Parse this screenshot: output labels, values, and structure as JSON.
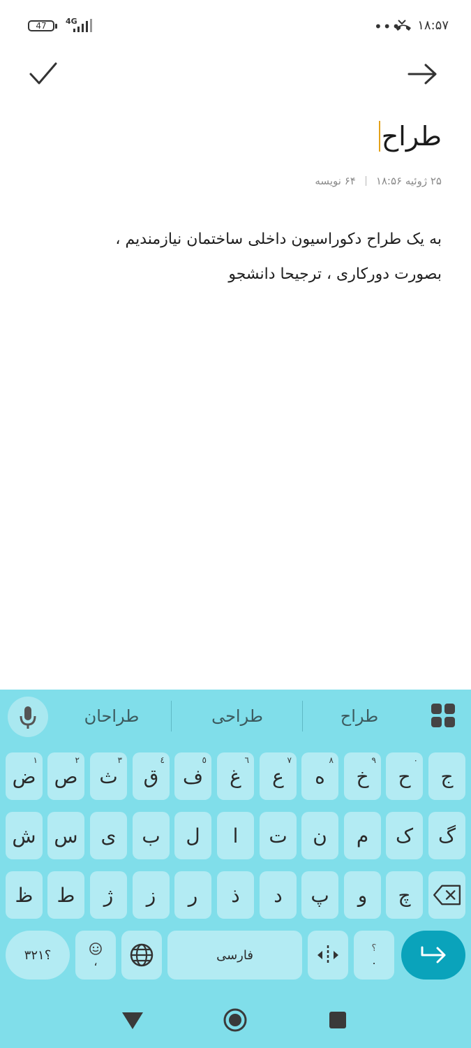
{
  "status_bar": {
    "battery": "47",
    "network": "4G",
    "time": "۱۸:۵۷",
    "more": "•••"
  },
  "note": {
    "title": "طراح",
    "date": "۲۵ ژوئیه ۱۸:۵۶",
    "char_count": "۶۴ نویسه",
    "line1": "به یک طراح دکوراسیون داخلی ساختمان نیازمندیم ،",
    "line2": "بصورت دورکاری ، ترجیحا دانشجو"
  },
  "keyboard": {
    "suggestions": [
      "طراح",
      "طراحی",
      "طراحان"
    ],
    "row1": [
      {
        "k": "ج",
        "h": ""
      },
      {
        "k": "ح",
        "h": "٠"
      },
      {
        "k": "خ",
        "h": "٩"
      },
      {
        "k": "ه",
        "h": "٨"
      },
      {
        "k": "ع",
        "h": "٧"
      },
      {
        "k": "غ",
        "h": "٦"
      },
      {
        "k": "ف",
        "h": "٥"
      },
      {
        "k": "ق",
        "h": "٤"
      },
      {
        "k": "ث",
        "h": "٣"
      },
      {
        "k": "ص",
        "h": "٢"
      },
      {
        "k": "ض",
        "h": "١"
      }
    ],
    "row2": [
      "گ",
      "ک",
      "م",
      "ن",
      "ت",
      "ا",
      "ل",
      "ب",
      "ی",
      "س",
      "ش"
    ],
    "row3": [
      "چ",
      "و",
      "پ",
      "د",
      "ذ",
      "ر",
      "ز",
      "ژ",
      "ط",
      "ظ"
    ],
    "symbols_key": "؟۳۲۱",
    "emoji_sub": "،",
    "space_label": "فارسی",
    "punct_top": "؟",
    "punct_bottom": "."
  },
  "colors": {
    "keyboard_bg": "#80deea",
    "key_bg": "#b3ebf3",
    "enter_bg": "#0aa3bb",
    "cursor": "#e3a21a"
  }
}
